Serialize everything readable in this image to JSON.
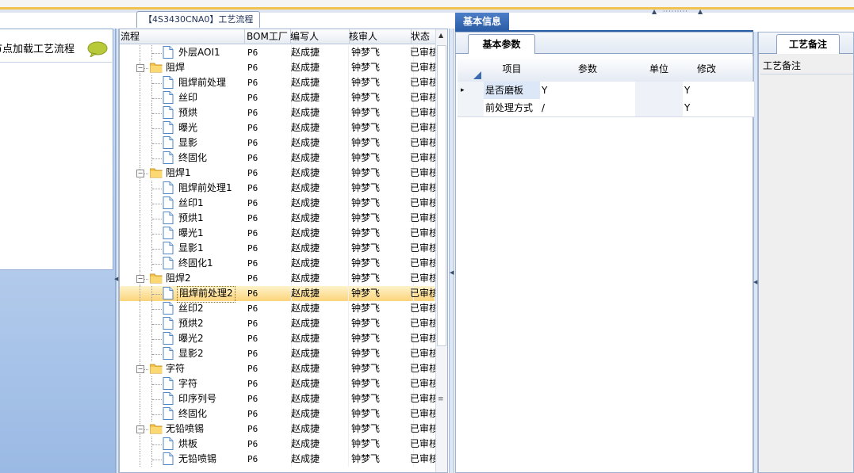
{
  "left_panel": {
    "title": "节点加载工艺流程",
    "icon": "chat-bubble-icon"
  },
  "center": {
    "tab_label": "【4S3430CNA0】工艺流程",
    "columns": [
      "流程",
      "BOM工厂",
      "编写人",
      "核审人",
      "状态"
    ],
    "rows": [
      {
        "label": "外层AOI1",
        "level": 1,
        "type": "file",
        "bom": "P6",
        "writer": "赵成捷",
        "reviewer": "钟梦飞",
        "status": "已审核"
      },
      {
        "label": "阻焊",
        "level": 0,
        "type": "folder",
        "bom": "P6",
        "writer": "赵成捷",
        "reviewer": "钟梦飞",
        "status": "已审核"
      },
      {
        "label": "阻焊前处理",
        "level": 1,
        "type": "file",
        "bom": "P6",
        "writer": "赵成捷",
        "reviewer": "钟梦飞",
        "status": "已审核"
      },
      {
        "label": "丝印",
        "level": 1,
        "type": "file",
        "bom": "P6",
        "writer": "赵成捷",
        "reviewer": "钟梦飞",
        "status": "已审核"
      },
      {
        "label": "预烘",
        "level": 1,
        "type": "file",
        "bom": "P6",
        "writer": "赵成捷",
        "reviewer": "钟梦飞",
        "status": "已审核"
      },
      {
        "label": "曝光",
        "level": 1,
        "type": "file",
        "bom": "P6",
        "writer": "赵成捷",
        "reviewer": "钟梦飞",
        "status": "已审核"
      },
      {
        "label": "显影",
        "level": 1,
        "type": "file",
        "bom": "P6",
        "writer": "赵成捷",
        "reviewer": "钟梦飞",
        "status": "已审核"
      },
      {
        "label": "终固化",
        "level": 1,
        "type": "file",
        "bom": "P6",
        "writer": "赵成捷",
        "reviewer": "钟梦飞",
        "status": "已审核"
      },
      {
        "label": "阻焊1",
        "level": 0,
        "type": "folder",
        "bom": "P6",
        "writer": "赵成捷",
        "reviewer": "钟梦飞",
        "status": "已审核"
      },
      {
        "label": "阻焊前处理1",
        "level": 1,
        "type": "file",
        "bom": "P6",
        "writer": "赵成捷",
        "reviewer": "钟梦飞",
        "status": "已审核"
      },
      {
        "label": "丝印1",
        "level": 1,
        "type": "file",
        "bom": "P6",
        "writer": "赵成捷",
        "reviewer": "钟梦飞",
        "status": "已审核"
      },
      {
        "label": "预烘1",
        "level": 1,
        "type": "file",
        "bom": "P6",
        "writer": "赵成捷",
        "reviewer": "钟梦飞",
        "status": "已审核"
      },
      {
        "label": "曝光1",
        "level": 1,
        "type": "file",
        "bom": "P6",
        "writer": "赵成捷",
        "reviewer": "钟梦飞",
        "status": "已审核"
      },
      {
        "label": "显影1",
        "level": 1,
        "type": "file",
        "bom": "P6",
        "writer": "赵成捷",
        "reviewer": "钟梦飞",
        "status": "已审核"
      },
      {
        "label": "终固化1",
        "level": 1,
        "type": "file",
        "bom": "P6",
        "writer": "赵成捷",
        "reviewer": "钟梦飞",
        "status": "已审核"
      },
      {
        "label": "阻焊2",
        "level": 0,
        "type": "folder",
        "bom": "P6",
        "writer": "赵成捷",
        "reviewer": "钟梦飞",
        "status": "已审核"
      },
      {
        "label": "阻焊前处理2",
        "level": 1,
        "type": "file",
        "bom": "P6",
        "writer": "赵成捷",
        "reviewer": "钟梦飞",
        "status": "已审核",
        "selected": true
      },
      {
        "label": "丝印2",
        "level": 1,
        "type": "file",
        "bom": "P6",
        "writer": "赵成捷",
        "reviewer": "钟梦飞",
        "status": "已审核"
      },
      {
        "label": "预烘2",
        "level": 1,
        "type": "file",
        "bom": "P6",
        "writer": "赵成捷",
        "reviewer": "钟梦飞",
        "status": "已审核"
      },
      {
        "label": "曝光2",
        "level": 1,
        "type": "file",
        "bom": "P6",
        "writer": "赵成捷",
        "reviewer": "钟梦飞",
        "status": "已审核"
      },
      {
        "label": "显影2",
        "level": 1,
        "type": "file",
        "bom": "P6",
        "writer": "赵成捷",
        "reviewer": "钟梦飞",
        "status": "已审核"
      },
      {
        "label": "字符",
        "level": 0,
        "type": "folder",
        "bom": "P6",
        "writer": "赵成捷",
        "reviewer": "钟梦飞",
        "status": "已审核"
      },
      {
        "label": "字符",
        "level": 1,
        "type": "file",
        "bom": "P6",
        "writer": "赵成捷",
        "reviewer": "钟梦飞",
        "status": "已审核"
      },
      {
        "label": "印序列号",
        "level": 1,
        "type": "file",
        "bom": "P6",
        "writer": "赵成捷",
        "reviewer": "钟梦飞",
        "status": "已审核"
      },
      {
        "label": "终固化",
        "level": 1,
        "type": "file",
        "bom": "P6",
        "writer": "赵成捷",
        "reviewer": "钟梦飞",
        "status": "已审核"
      },
      {
        "label": "无铅喷锡",
        "level": 0,
        "type": "folder",
        "bom": "P6",
        "writer": "赵成捷",
        "reviewer": "钟梦飞",
        "status": "已审核"
      },
      {
        "label": "烘板",
        "level": 1,
        "type": "file",
        "bom": "P6",
        "writer": "赵成捷",
        "reviewer": "钟梦飞",
        "status": "已审核"
      },
      {
        "label": "无铅喷锡",
        "level": 1,
        "type": "file",
        "bom": "P6",
        "writer": "赵成捷",
        "reviewer": "钟梦飞",
        "status": "已审核"
      }
    ]
  },
  "basic_info": {
    "tab_label": "基本信息",
    "sub_tab_label": "基本参数",
    "columns": [
      "项目",
      "参数",
      "单位",
      "修改"
    ],
    "rows": [
      {
        "item": "是否磨板",
        "param": "Y",
        "unit": "",
        "modify": "Y",
        "current": true
      },
      {
        "item": "前处理方式",
        "param": "/",
        "unit": "",
        "modify": "Y",
        "current": false
      }
    ]
  },
  "notes": {
    "tab_label": "工艺备注",
    "field_label": "工艺备注"
  },
  "colors": {
    "accent_blue": "#2c5ea8",
    "selection": "#fbd47a",
    "top_line": "#f1c24e"
  }
}
